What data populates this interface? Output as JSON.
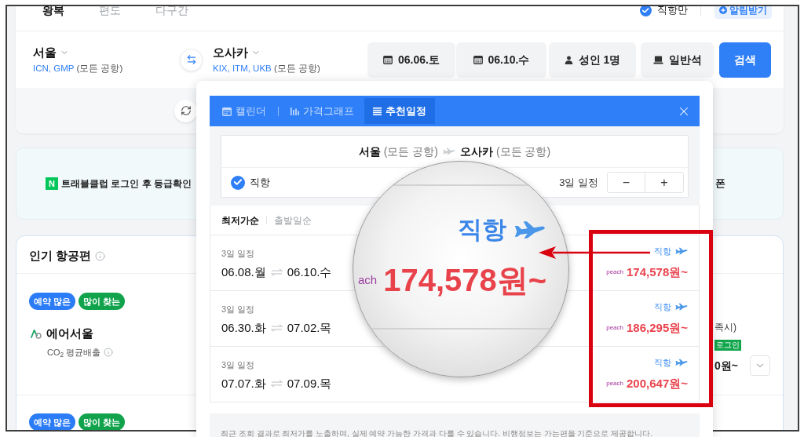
{
  "trip_tabs": [
    {
      "label": "왕복",
      "selected": true
    },
    {
      "label": "편도",
      "selected": false
    },
    {
      "label": "다구간",
      "selected": false
    }
  ],
  "direct_only": {
    "label": "직항만",
    "checked": true
  },
  "alert_button": "알림받기",
  "search": {
    "origin": {
      "city": "서울",
      "codes": "ICN, GMP",
      "note": "(모든 공항)"
    },
    "destination": {
      "city": "오사카",
      "codes": "KIX, ITM, UKB",
      "note": "(모든 공항)"
    },
    "fields": [
      {
        "kind": "date",
        "value": "06.06.토"
      },
      {
        "kind": "date",
        "value": "06.10.수"
      },
      {
        "kind": "passengers",
        "value": "성인 1명"
      },
      {
        "kind": "cabin",
        "value": "일반석"
      }
    ],
    "button": "검색"
  },
  "banner": {
    "logo": "N",
    "text": "트래블클럽 로그인 후 등급확인",
    "right_text": "폰"
  },
  "popular": {
    "title": "인기 항공편",
    "items": [
      {
        "badges": [
          {
            "label": "예약 많은",
            "color": "#2b7cf6"
          },
          {
            "label": "많이 찾는",
            "color": "#10a34c"
          }
        ],
        "airline": "에어서울",
        "emission": "CO$_{2}$ 평균배출",
        "side_note": "족시)",
        "side_badge": "로그인",
        "side_price": "0원~"
      },
      {
        "badges": [
          {
            "label": "예약 많은",
            "color": "#2b7cf6"
          },
          {
            "label": "많이 찾는",
            "color": "#10a34c"
          }
        ]
      }
    ]
  },
  "calendar_popup": {
    "tabs": [
      {
        "kind": "calendar",
        "label": "캘린더",
        "selected": false
      },
      {
        "kind": "graph",
        "label": "가격그래프",
        "selected": false
      },
      {
        "kind": "list",
        "label": "추천일정",
        "selected": true
      }
    ],
    "route": {
      "from": "서울",
      "from_note": "(모든 공항)",
      "to": "오사카",
      "to_note": "(모든 공항)"
    },
    "direct": {
      "label": "직항",
      "checked": true
    },
    "duration": {
      "label": "3일 일정",
      "minus": "−",
      "plus": "+"
    },
    "sort_tabs": [
      {
        "label": "최저가순",
        "selected": true
      },
      {
        "label": "출발일순",
        "selected": false
      }
    ],
    "results": [
      {
        "length": "3일 일정",
        "depart": "06.08.월",
        "return": "06.10.수",
        "tag": "직항",
        "airline": "peach",
        "price": "174,578원~"
      },
      {
        "length": "3일 일정",
        "depart": "06.30.화",
        "return": "07.02.목",
        "tag": "직항",
        "airline": "peach",
        "price": "186,295원~"
      },
      {
        "length": "3일 일정",
        "depart": "07.07.화",
        "return": "07.09.목",
        "tag": "직항",
        "airline": "peach",
        "price": "200,647원~"
      }
    ],
    "note": "최근 조회 결과로 최저가를 노출하며, 실제 예약 가능한 가격과 다를 수 있습니다. 비행정보는 가는편을 기준으로 제공합니다."
  },
  "magnifier": {
    "tag": "직항",
    "airline": "ach",
    "price": "174,578원~"
  }
}
